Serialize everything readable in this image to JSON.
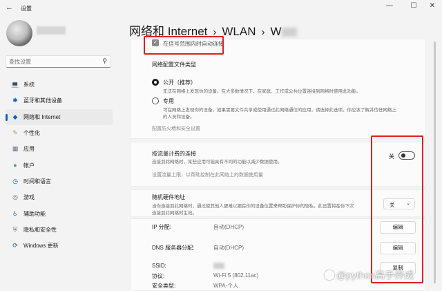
{
  "window": {
    "title": "设置",
    "back_icon": "←",
    "minimize": "—",
    "maximize": "☐",
    "close": "✕"
  },
  "sidebar": {
    "search_placeholder": "查找设置",
    "items": [
      {
        "label": "系统",
        "icon": "💻",
        "color": "#0067c0"
      },
      {
        "label": "蓝牙和其他设备",
        "icon": "✱",
        "color": "#0067c0"
      },
      {
        "label": "网络和 Internet",
        "icon": "◆",
        "color": "#0067c0",
        "active": true
      },
      {
        "label": "个性化",
        "icon": "✎",
        "color": "#d78a2c"
      },
      {
        "label": "应用",
        "icon": "▦",
        "color": "#6a6a8a"
      },
      {
        "label": "帐户",
        "icon": "●",
        "color": "#3aa55c"
      },
      {
        "label": "时间和语言",
        "icon": "◷",
        "color": "#0067c0"
      },
      {
        "label": "游戏",
        "icon": "◎",
        "color": "#6a6a6a"
      },
      {
        "label": "辅助功能",
        "icon": "♿",
        "color": "#2a6fc9"
      },
      {
        "label": "隐私和安全性",
        "icon": "⛨",
        "color": "#6a6a6a"
      },
      {
        "label": "Windows 更新",
        "icon": "⟳",
        "color": "#0067c0"
      }
    ]
  },
  "header": {
    "crumb1": "网络和 Internet",
    "crumb2": "WLAN",
    "crumb3": "W",
    "sep": "›"
  },
  "settings": {
    "auto_connect": "在信号范围内时自动连接",
    "profile_type_label": "网络配置文件类型",
    "public_title": "公开（推荐）",
    "public_desc": "无法在网络上发现你的设备。在大多数情况下，在家庭、工作或公共位置连接到网络时使用此功能。",
    "private_title": "专用",
    "private_desc_1": "可在网络上发现你的设备。如果需要文件共享或使用通过此网络通信的应用，请选择此选项。你应该了解并信任网络上",
    "private_desc_2": "的人员和设备。",
    "firewall_link": "配置防火墙和安全设置",
    "metered_title": "按流量计费的连接",
    "metered_desc": "连接到此网络时，某些应用可能具有不同的功能以减少数据使用。",
    "metered_state": "关",
    "data_limit_link": "设置流量上限，以帮助控制在此网络上的数据使用量",
    "random_mac_title": "随机硬件地址",
    "random_mac_desc_1": "当你连接到此网络时，通过使其他人更难以跟踪你的设备位置来帮助保护你的隐私。此设置将在你下次",
    "random_mac_desc_2": "连接到此网络时生效。",
    "random_mac_value": "关",
    "ip_label": "IP 分配:",
    "ip_value": "自动(DHCP)",
    "dns_label": "DNS 服务器分配:",
    "dns_value": "自动(DHCP)",
    "edit_label": "编辑",
    "copy_label": "复制",
    "ssid_label": "SSID:",
    "protocol_label": "协议:",
    "protocol_value": "Wi-Fi 5 (802.11ac)",
    "security_label": "安全类型:",
    "security_value": "WPA-个人"
  },
  "watermark": "@python高手养成",
  "colors": {
    "accent": "#0067c0",
    "highlight": "#e02020"
  }
}
